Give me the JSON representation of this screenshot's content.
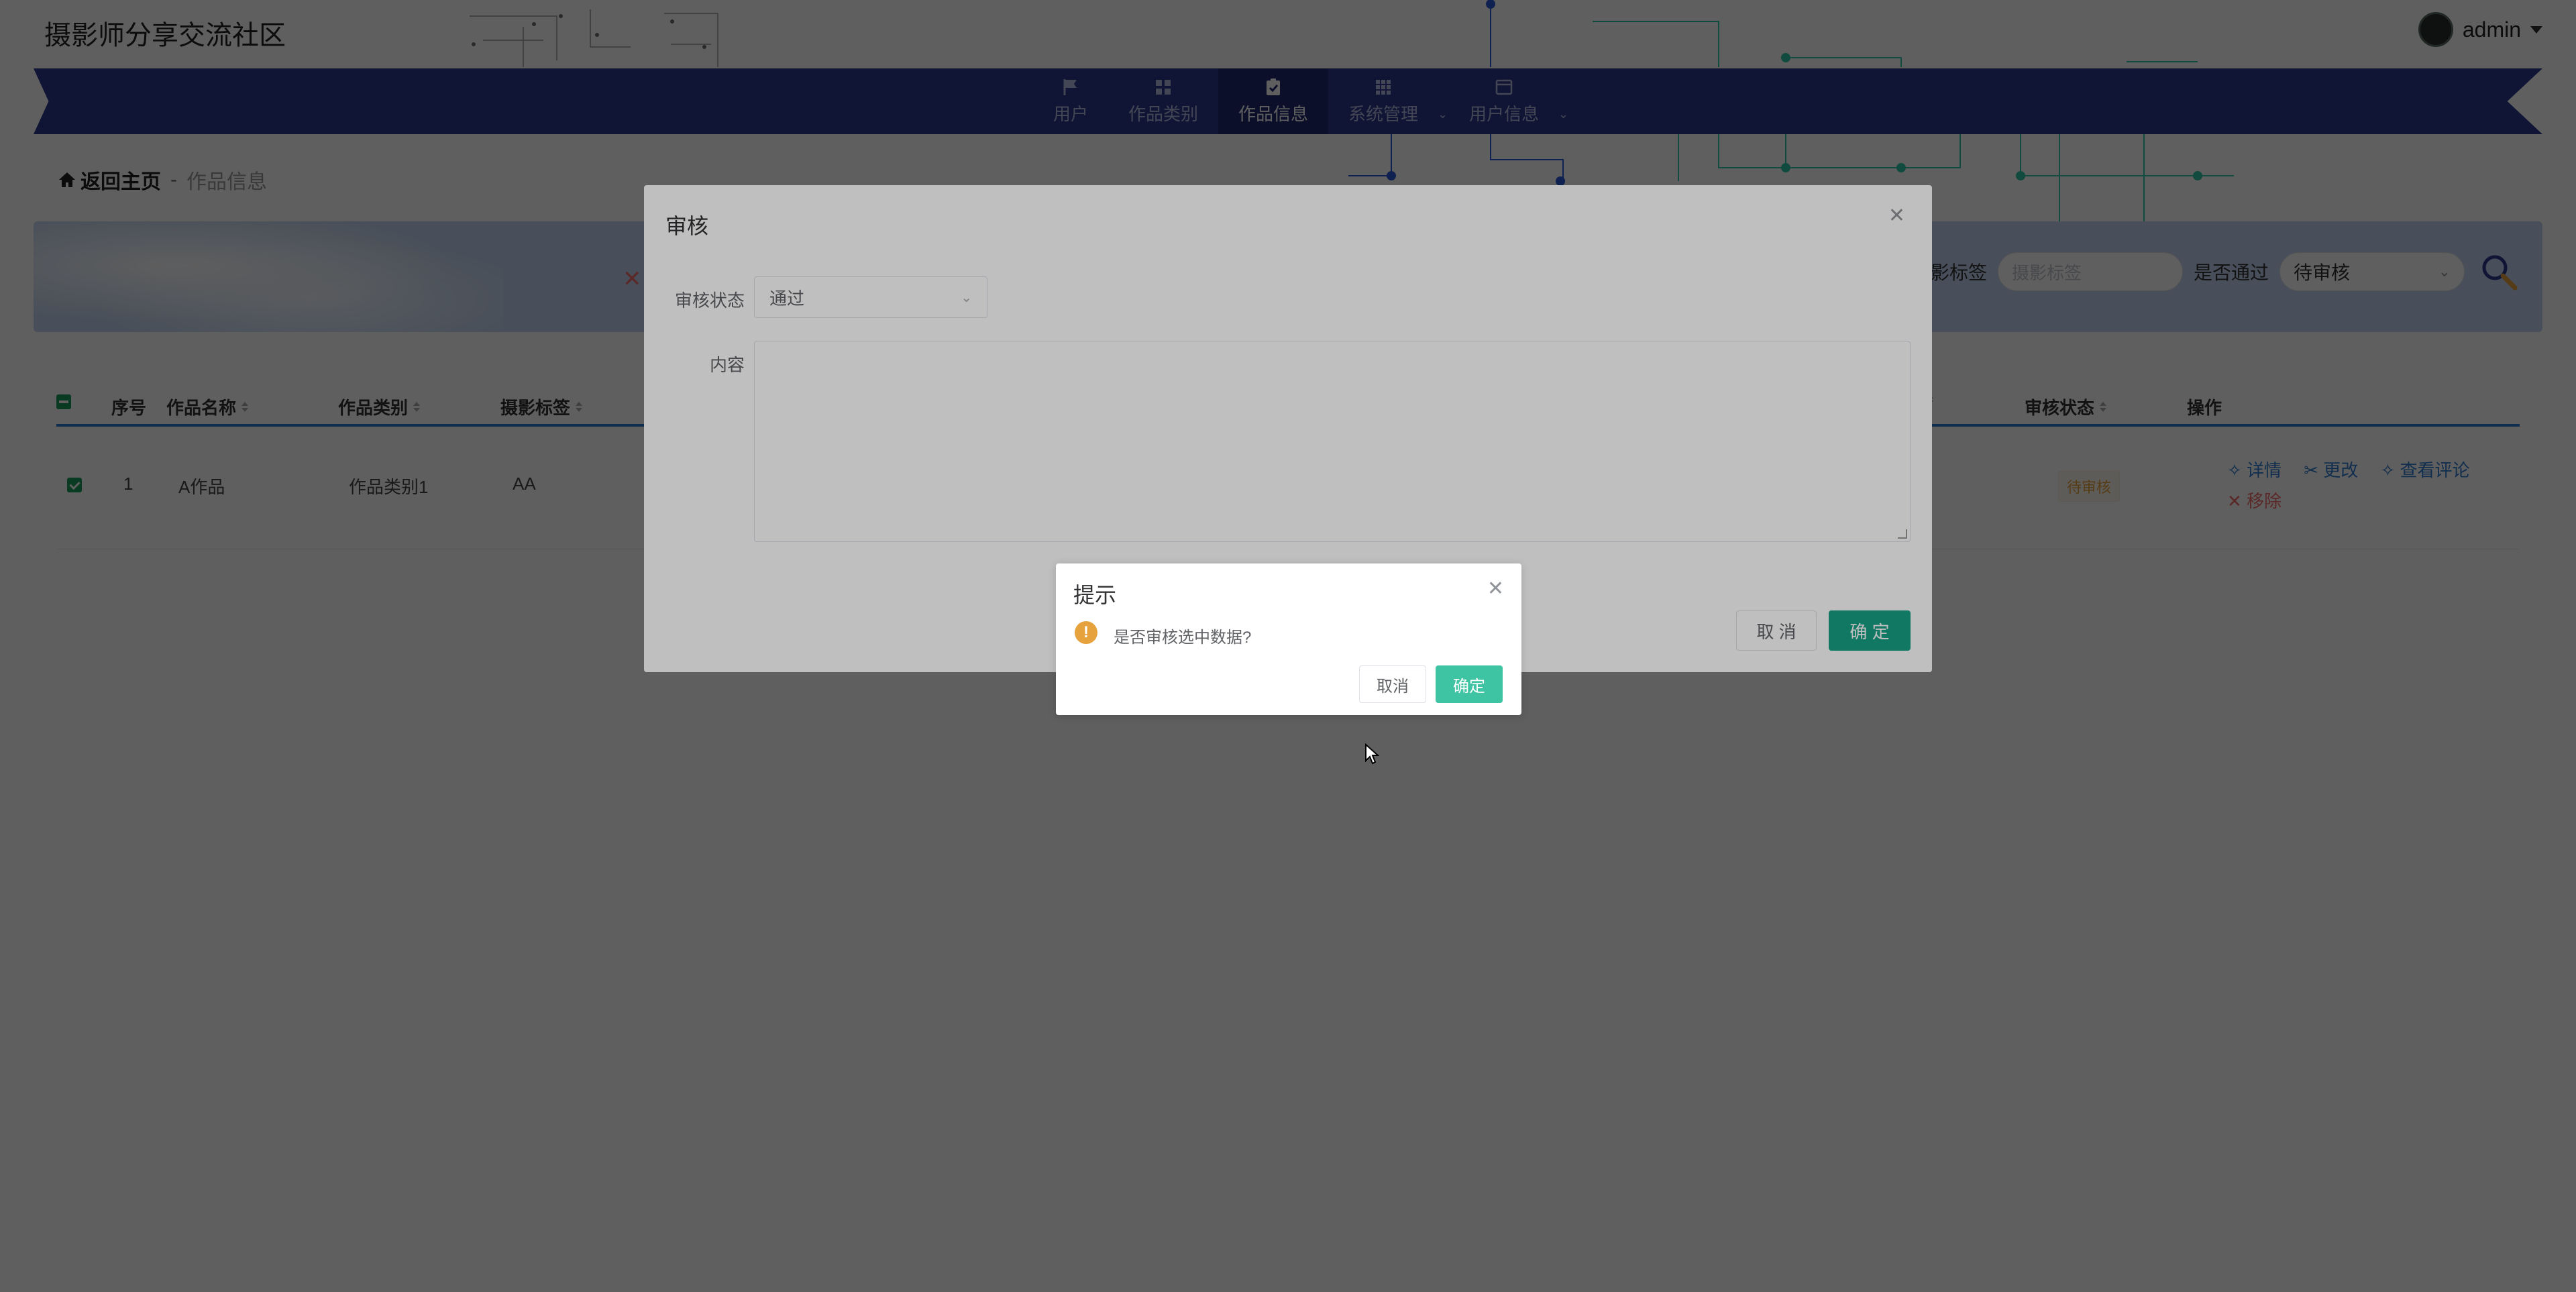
{
  "header": {
    "site_title": "摄影师分享交流社区",
    "username": "admin"
  },
  "nav": {
    "items": [
      {
        "label": "用户",
        "icon": "flag-icon"
      },
      {
        "label": "作品类别",
        "icon": "grid-icon"
      },
      {
        "label": "作品信息",
        "icon": "clipboard-check-icon",
        "active": true
      },
      {
        "label": "系统管理",
        "icon": "apps-grid-icon",
        "has_submenu": true
      },
      {
        "label": "用户信息",
        "icon": "window-icon",
        "has_submenu": true
      }
    ]
  },
  "breadcrumb": {
    "home": "返回主页",
    "separator": "-",
    "current": "作品信息"
  },
  "search": {
    "tag_label": "影标签",
    "tag_placeholder": "摄影标签",
    "pass_label": "是否通过",
    "pass_value": "待审核"
  },
  "table": {
    "headers": {
      "index": "序号",
      "name": "作品名称",
      "category": "作品类别",
      "tag": "摄影标签",
      "status": "审核状态",
      "actions": "操作"
    },
    "rows": [
      {
        "index": "1",
        "name": "A作品",
        "category": "作品类别1",
        "tag": "AA",
        "status": "待审核"
      }
    ],
    "actions": {
      "detail": "详情",
      "edit": "更改",
      "comments": "查看评论",
      "remove": "移除"
    }
  },
  "review_dialog": {
    "title": "审核",
    "status_label": "审核状态",
    "status_value": "通过",
    "content_label": "内容",
    "cancel": "取 消",
    "confirm": "确 定"
  },
  "confirm_box": {
    "title": "提示",
    "message": "是否审核选中数据?",
    "cancel": "取消",
    "confirm": "确定"
  },
  "colors": {
    "nav_bg": "#2c3a8e",
    "primary": "#17a085",
    "warning": "#e6a23c",
    "link": "#2f7dd3",
    "danger": "#f56c6c"
  }
}
